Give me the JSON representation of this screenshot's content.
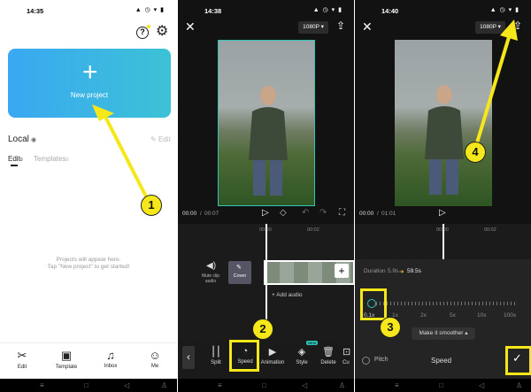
{
  "panel1": {
    "time": "14:35",
    "new_project_label": "New project",
    "local_label": "Local",
    "edit_label": "Edit",
    "tab_edit": "Edit",
    "tab_edit_count": "0",
    "tab_templates": "Templates",
    "tab_templates_count": "0",
    "empty_line1": "Projects will appear here.",
    "empty_line2": "Tap \"New project\" to get started!",
    "bottom_tabs": [
      {
        "label": "Edit",
        "icon": "scissors-icon"
      },
      {
        "label": "Template",
        "icon": "template-icon"
      },
      {
        "label": "Inbox",
        "icon": "bell-icon"
      },
      {
        "label": "Me",
        "icon": "person-icon"
      }
    ],
    "badge": "1"
  },
  "panel2": {
    "time": "14:38",
    "resolution": "1080P",
    "time_current": "00:00",
    "time_total": "00:07",
    "ruler": [
      "00:00",
      "00:02"
    ],
    "mute_label": "Mute clip audio",
    "cover_label": "Cover",
    "add_audio": "+ Add audio",
    "tools": [
      "Split",
      "Speed",
      "Animation",
      "Style",
      "Delete",
      "Cu"
    ],
    "style_new": "NEW",
    "badge": "2"
  },
  "panel3": {
    "time": "14:40",
    "resolution": "1080P",
    "time_current": "00:00",
    "time_total": "01:01",
    "ruler": [
      "00:00",
      "00:02"
    ],
    "duration_label": "Duration",
    "duration_from": "5.9s",
    "duration_to": "59.5s",
    "speed_marks": [
      "0.1x",
      "1x",
      "2x",
      "5x",
      "10x",
      "100x"
    ],
    "speed_value": 0.1,
    "smooth_label": "Make it smoother",
    "pitch_label": "Pitch",
    "panel_title": "Speed",
    "badge_3": "3",
    "badge_4": "4"
  },
  "colors": {
    "highlight": "#f6e71a",
    "accent": "#2ec4b6",
    "gradient_start": "#3fb9f0",
    "gradient_end": "#3fc4d8"
  }
}
